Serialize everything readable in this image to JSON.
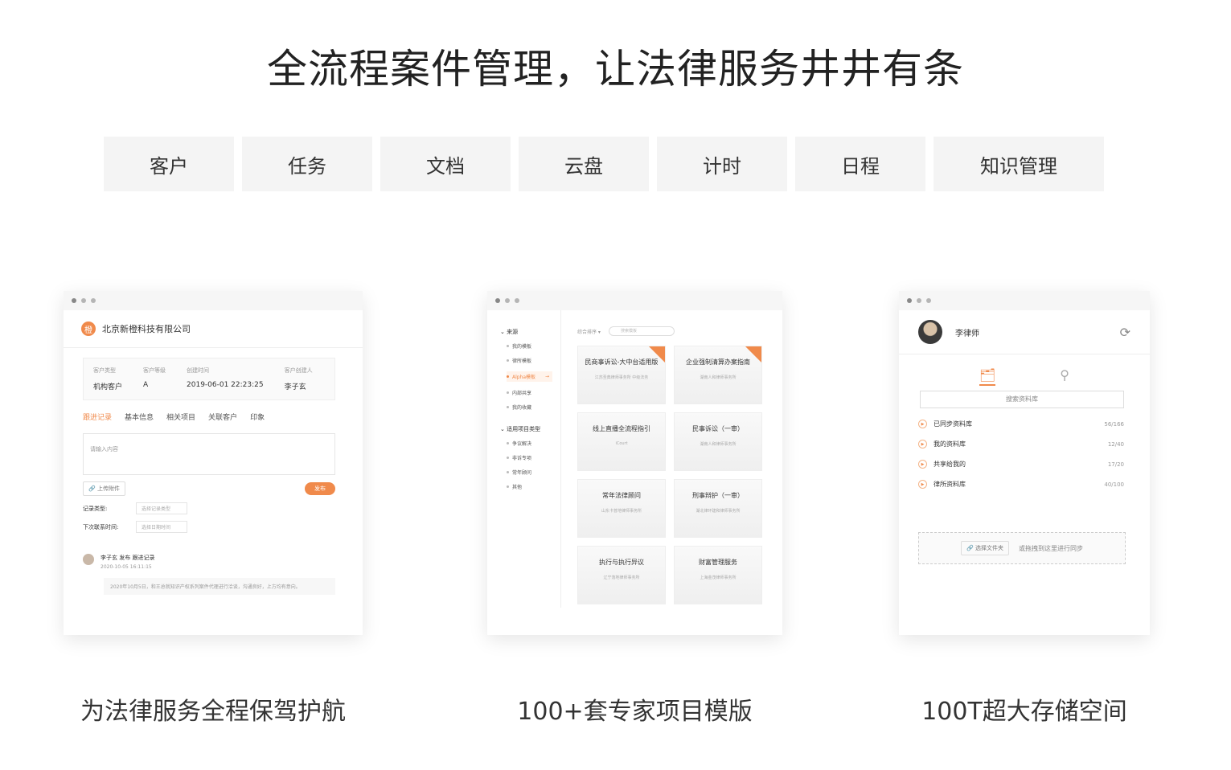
{
  "headline": "全流程案件管理，让法律服务井井有条",
  "tabs": [
    "客户",
    "任务",
    "文档",
    "云盘",
    "计时",
    "日程",
    "知识管理"
  ],
  "shot1": {
    "company": "北京新橙科技有限公司",
    "logo_char": "橙",
    "fields": [
      {
        "label": "客户类型",
        "value": "机构客户"
      },
      {
        "label": "客户等级",
        "value": "A"
      },
      {
        "label": "创建时间",
        "value": "2019-06-01 22:23:25"
      },
      {
        "label": "客户创建人",
        "value": "李子玄"
      }
    ],
    "tabs": [
      "跟进记录",
      "基本信息",
      "相关项目",
      "关联客户",
      "印象"
    ],
    "placeholder": "请输入内容",
    "upload": "上传附件",
    "publish": "发布",
    "record_type_label": "记录类型:",
    "record_type_select": "选择记录类型",
    "next_time_label": "下次联系时间:",
    "next_time_select": "选择日期时间",
    "log_author": "李子玄",
    "log_action": "发布 跟进记录",
    "log_time": "2020-10-05 16:11:15",
    "log_text": "2020年10月5日，和王总就知识产权系列案件代理进行洽谈，沟通良好，上方均有意向。"
  },
  "shot2": {
    "sidebar": [
      {
        "group": "来源",
        "items": [
          "我的模板",
          "律所模板",
          "Alpha模板",
          "内部共享",
          "我的收藏"
        ],
        "active": "Alpha模板"
      },
      {
        "group": "适用项目类型",
        "items": [
          "争议解决",
          "非诉专项",
          "常年顾问",
          "其他"
        ]
      }
    ],
    "sort": "综合排序",
    "search_placeholder": "搜索模板",
    "templates": [
      {
        "title": "民商事诉讼-大中台适用版",
        "sub": "江苏圣典律师事务所 中级法务",
        "tag": true
      },
      {
        "title": "企业强制清算办案指南",
        "sub": "湖南人和律师事务所",
        "tag": true
      },
      {
        "title": "线上直播全流程指引",
        "sub": "iCourt",
        "tag": false
      },
      {
        "title": "民事诉讼（一审）",
        "sub": "湖南人和律师事务所",
        "tag": false
      },
      {
        "title": "常年法律顾问",
        "sub": "山东卡普地律师事务所",
        "tag": false
      },
      {
        "title": "刑事辩护（一审）",
        "sub": "湖北律环建和律师事务所",
        "tag": false
      },
      {
        "title": "执行与执行异议",
        "sub": "辽宁落地律师事务所",
        "tag": false
      },
      {
        "title": "财富管理服务",
        "sub": "上海金茂律师事务所",
        "tag": false
      }
    ]
  },
  "shot3": {
    "user": "李律师",
    "search": "搜索资料库",
    "libraries": [
      {
        "name": "已同步资料库",
        "count": "56/166"
      },
      {
        "name": "我的资料库",
        "count": "12/40"
      },
      {
        "name": "共享给我的",
        "count": "17/20"
      },
      {
        "name": "律所资料库",
        "count": "40/100"
      }
    ],
    "choose": "选择文件夹",
    "drop": "或拖拽到这里进行同步"
  },
  "captions": [
    "为法律服务全程保驾护航",
    "100+套专家项目模版",
    "100T超大存储空间"
  ],
  "colors": {
    "accent": "#f08a4b",
    "tab_bg": "#f4f4f4"
  }
}
